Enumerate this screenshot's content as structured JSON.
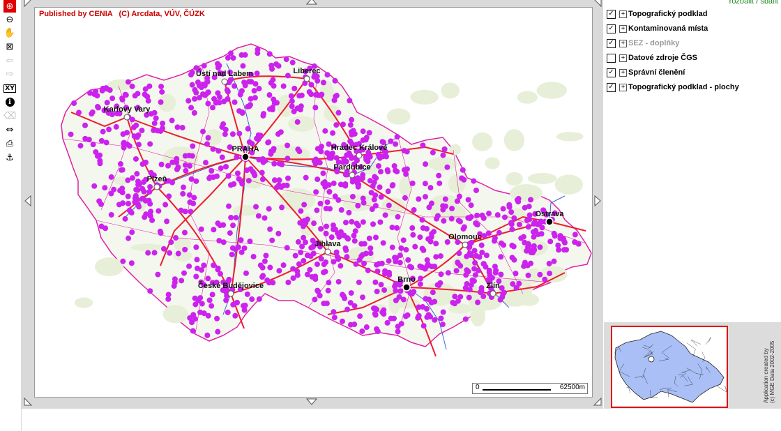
{
  "toolbar": {
    "tools": [
      {
        "name": "zoom-in-tool",
        "icon": "zoom-in-icon",
        "glyph": "⊕",
        "active": true
      },
      {
        "name": "zoom-out-tool",
        "icon": "zoom-out-icon",
        "glyph": "⊖",
        "active": false
      },
      {
        "name": "pan-tool",
        "icon": "hand-icon",
        "glyph": "✋",
        "active": false
      },
      {
        "name": "full-extent-tool",
        "icon": "full-extent-icon",
        "glyph": "⊠",
        "active": false
      },
      {
        "name": "back-tool",
        "icon": "arrow-left-icon",
        "glyph": "⇦",
        "active": false,
        "disabled": true
      },
      {
        "name": "forward-tool",
        "icon": "arrow-right-icon",
        "glyph": "⇨",
        "active": false,
        "disabled": true
      },
      {
        "name": "xy-tool",
        "icon": "xy-coordinates-icon",
        "glyph": "XY",
        "active": false
      },
      {
        "name": "identify-tool",
        "icon": "info-icon",
        "glyph": "ℹ",
        "active": false
      },
      {
        "name": "erase-tool",
        "icon": "eraser-icon",
        "glyph": "⌫",
        "active": false,
        "disabled": true
      },
      {
        "name": "measure-tool",
        "icon": "measure-icon",
        "glyph": "⇔",
        "active": false
      },
      {
        "name": "print-tool",
        "icon": "printer-icon",
        "glyph": "⎙",
        "active": false
      },
      {
        "name": "anchor-tool",
        "icon": "anchor-icon",
        "glyph": "⚓",
        "active": false
      }
    ]
  },
  "map": {
    "credits": "Published by CENIA   (C) Arcdata, VÚV, ČÚZK",
    "scale": {
      "start": "0",
      "end": "62500m"
    },
    "cities": [
      {
        "name": "Ústí nad Labem",
        "big": false
      },
      {
        "name": "Liberec",
        "big": false
      },
      {
        "name": "Karlovy Vary",
        "big": false
      },
      {
        "name": "PRAHA",
        "big": true
      },
      {
        "name": "Hradec Králové",
        "big": false
      },
      {
        "name": "Pardubice",
        "big": false
      },
      {
        "name": "Plzeň",
        "big": false
      },
      {
        "name": "Ostrava",
        "big": true
      },
      {
        "name": "Olomouc",
        "big": false
      },
      {
        "name": "Jihlava",
        "big": false
      },
      {
        "name": "Brno",
        "big": true
      },
      {
        "name": "Zlín",
        "big": false
      },
      {
        "name": "České Budějovice",
        "big": false
      }
    ],
    "colors": {
      "border": "#e01fa8",
      "points": "#cc22ee",
      "roads": "#ee1c2e",
      "rivers": "#3a63d6",
      "urban": "#e8efd8"
    }
  },
  "layers_panel": {
    "expand_label": "rozbalit",
    "separator": "/",
    "collapse_label": "sbalit",
    "layers": [
      {
        "label": "Topografický podklad",
        "checked": true,
        "greyed": false
      },
      {
        "label": "Kontaminovaná místa",
        "checked": true,
        "greyed": false
      },
      {
        "label": "SEZ - doplňky",
        "checked": true,
        "greyed": true
      },
      {
        "label": "Datové zdroje ČGS",
        "checked": false,
        "greyed": false
      },
      {
        "label": "Správní členění",
        "checked": true,
        "greyed": false
      },
      {
        "label": "Topografický podklad - plochy",
        "checked": true,
        "greyed": false
      }
    ]
  },
  "overview": {
    "app_credit_line1": "Application created by",
    "app_credit_line2": "(c) MGE Data 2002-2005"
  }
}
